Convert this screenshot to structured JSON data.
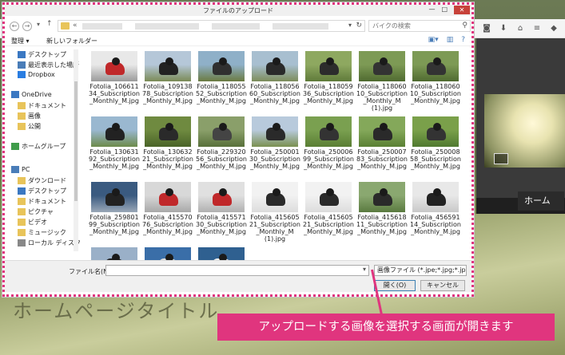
{
  "background": {
    "nav_home": "ホーム",
    "page_title": "ホームページタイトル",
    "toolbar_icons": [
      "pocket-icon",
      "download-icon",
      "home-icon",
      "menu-icon",
      "extension-icon"
    ]
  },
  "dialog": {
    "title": "ファイルのアップロード",
    "search_placeholder": "バイクの検索",
    "organize_label": "整理 ▾",
    "new_folder_label": "新しいフォルダー",
    "nav_items": [
      {
        "label": "デスクトップ",
        "icon": "desktop-icon",
        "color": "#3b78c2"
      },
      {
        "label": "最近表示した場所",
        "icon": "recent-places-icon",
        "color": "#4a7db8"
      },
      {
        "label": "Dropbox",
        "icon": "dropbox-icon",
        "color": "#2a7de1"
      },
      {
        "label": "OneDrive",
        "icon": "onedrive-icon",
        "color": "#3b78c2"
      },
      {
        "label": "ドキュメント",
        "icon": "folder-icon",
        "color": "#e8c45a"
      },
      {
        "label": "画像",
        "icon": "folder-icon",
        "color": "#e8c45a"
      },
      {
        "label": "公開",
        "icon": "folder-icon",
        "color": "#e8c45a"
      },
      {
        "label": "ホームグループ",
        "icon": "homegroup-icon",
        "color": "#3f9c4a"
      },
      {
        "label": "PC",
        "icon": "pc-icon",
        "color": "#4a7db8"
      },
      {
        "label": "ダウンロード",
        "icon": "download-folder-icon",
        "color": "#e8c45a"
      },
      {
        "label": "デスクトップ",
        "icon": "desktop-icon",
        "color": "#3b78c2"
      },
      {
        "label": "ドキュメント",
        "icon": "document-folder-icon",
        "color": "#e8c45a"
      },
      {
        "label": "ピクチャ",
        "icon": "pictures-folder-icon",
        "color": "#e8c45a"
      },
      {
        "label": "ビデオ",
        "icon": "video-folder-icon",
        "color": "#e8c45a"
      },
      {
        "label": "ミュージック",
        "icon": "music-folder-icon",
        "color": "#e8c45a"
      },
      {
        "label": "ローカル ディスク (C",
        "icon": "drive-icon",
        "color": "#888888"
      }
    ],
    "files": [
      {
        "name": "Fotolia_106611\n34_Subscription\n_Monthly_M.jpg",
        "sky": "#e8e8e8",
        "ground": "#9a9a9a",
        "bike": "#c0282a"
      },
      {
        "name": "Fotolia_109138\n78_Subscription\n_Monthly_M.jpg",
        "sky": "#b5c7d8",
        "ground": "#7a8a55",
        "bike": "#222222"
      },
      {
        "name": "Fotolia_118055\n52_Subscription\n_Monthly_M.jpg",
        "sky": "#8fb0c8",
        "ground": "#6a7a40",
        "bike": "#303030"
      },
      {
        "name": "Fotolia_118056\n60_Subscription\n_Monthly_M.jpg",
        "sky": "#a8bfd0",
        "ground": "#7c8c5a",
        "bike": "#2a2a2a"
      },
      {
        "name": "Fotolia_118059\n36_Subscription\n_Monthly_M.jpg",
        "sky": "#8ea860",
        "ground": "#5f7a3a",
        "bike": "#2c2c2c"
      },
      {
        "name": "Fotolia_118060\n10_Subscription\n_Monthly_M\n(1).jpg",
        "sky": "#7d9a55",
        "ground": "#4f6a30",
        "bike": "#333333"
      },
      {
        "name": "Fotolia_118060\n10_Subscription\n_Monthly_M.jpg",
        "sky": "#7d9a55",
        "ground": "#4f6a30",
        "bike": "#333333"
      },
      {
        "name": "Fotolia_130631\n92_Subscription\n_Monthly_M.jpg",
        "sky": "#9ab8d0",
        "ground": "#6c8a4a",
        "bike": "#222222"
      },
      {
        "name": "Fotolia_130632\n21_Subscription\n_Monthly_M.jpg",
        "sky": "#6f8a40",
        "ground": "#4a6428",
        "bike": "#2a2a2a"
      },
      {
        "name": "Fotolia_229320\n56_Subscription\n_Monthly_M.jpg",
        "sky": "#8a9f6a",
        "ground": "#58703a",
        "bike": "#444444"
      },
      {
        "name": "Fotolia_250001\n30_Subscription\n_Monthly_M.jpg",
        "sky": "#b8cadc",
        "ground": "#7a9050",
        "bike": "#2a2a2a"
      },
      {
        "name": "Fotolia_250006\n99_Subscription\n_Monthly_M.jpg",
        "sky": "#7aa050",
        "ground": "#5a7e34",
        "bike": "#333333"
      },
      {
        "name": "Fotolia_250007\n83_Subscription\n_Monthly_M.jpg",
        "sky": "#84a85a",
        "ground": "#5a8034",
        "bike": "#2a2a2a"
      },
      {
        "name": "Fotolia_250008\n58_Subscription\n_Monthly_M.jpg",
        "sky": "#7aa04a",
        "ground": "#507a30",
        "bike": "#333333"
      },
      {
        "name": "Fotolia_259801\n99_Subscription\n_Monthly_M.jpg",
        "sky": "#3a5a80",
        "ground": "#9aa8b8",
        "bike": "#222222"
      },
      {
        "name": "Fotolia_415570\n76_Subscription\n_Monthly_M.jpg",
        "sky": "#d8d8d8",
        "ground": "#a8a8a8",
        "bike": "#c0282a"
      },
      {
        "name": "Fotolia_415571\n30_Subscription\n_Monthly_M.jpg",
        "sky": "#e0e0e0",
        "ground": "#b0b0b0",
        "bike": "#c0282a"
      },
      {
        "name": "Fotolia_415605\n21_Subscription\n_Monthly_M\n(1).jpg",
        "sky": "#f2f2f2",
        "ground": "#dcdcdc",
        "bike": "#2a2a2a"
      },
      {
        "name": "Fotolia_415605\n21_Subscription\n_Monthly_M.jpg",
        "sky": "#f2f2f2",
        "ground": "#dcdcdc",
        "bike": "#2a2a2a"
      },
      {
        "name": "Fotolia_415618\n11_Subscription\n_Monthly_M.jpg",
        "sky": "#8aa870",
        "ground": "#5a7a40",
        "bike": "#2a2a2a"
      },
      {
        "name": "Fotolia_456591\n14_Subscription\n_Monthly_M.jpg",
        "sky": "#e8e8e8",
        "ground": "#c8c8c8",
        "bike": "#222222"
      },
      {
        "name": "",
        "sky": "#9ab0c8",
        "ground": "#4a5a70",
        "bike": "#222222"
      },
      {
        "name": "",
        "sky": "#3a6ea8",
        "ground": "#1e3d66",
        "bike": "#dddddd"
      },
      {
        "name": "",
        "sky": "#2f6090",
        "ground": "#1a3550",
        "bike": "#eeeeee"
      }
    ],
    "filename_label": "ファイル名(N):",
    "filename_value": "",
    "filter_label": "画像ファイル (*.jpe;*.jpg;*.jpe",
    "open_button": "開く(O)",
    "cancel_button": "キャンセル"
  },
  "callout": {
    "text": "アップロードする画像を選択する画面が開きます",
    "color": "#e0357e"
  }
}
